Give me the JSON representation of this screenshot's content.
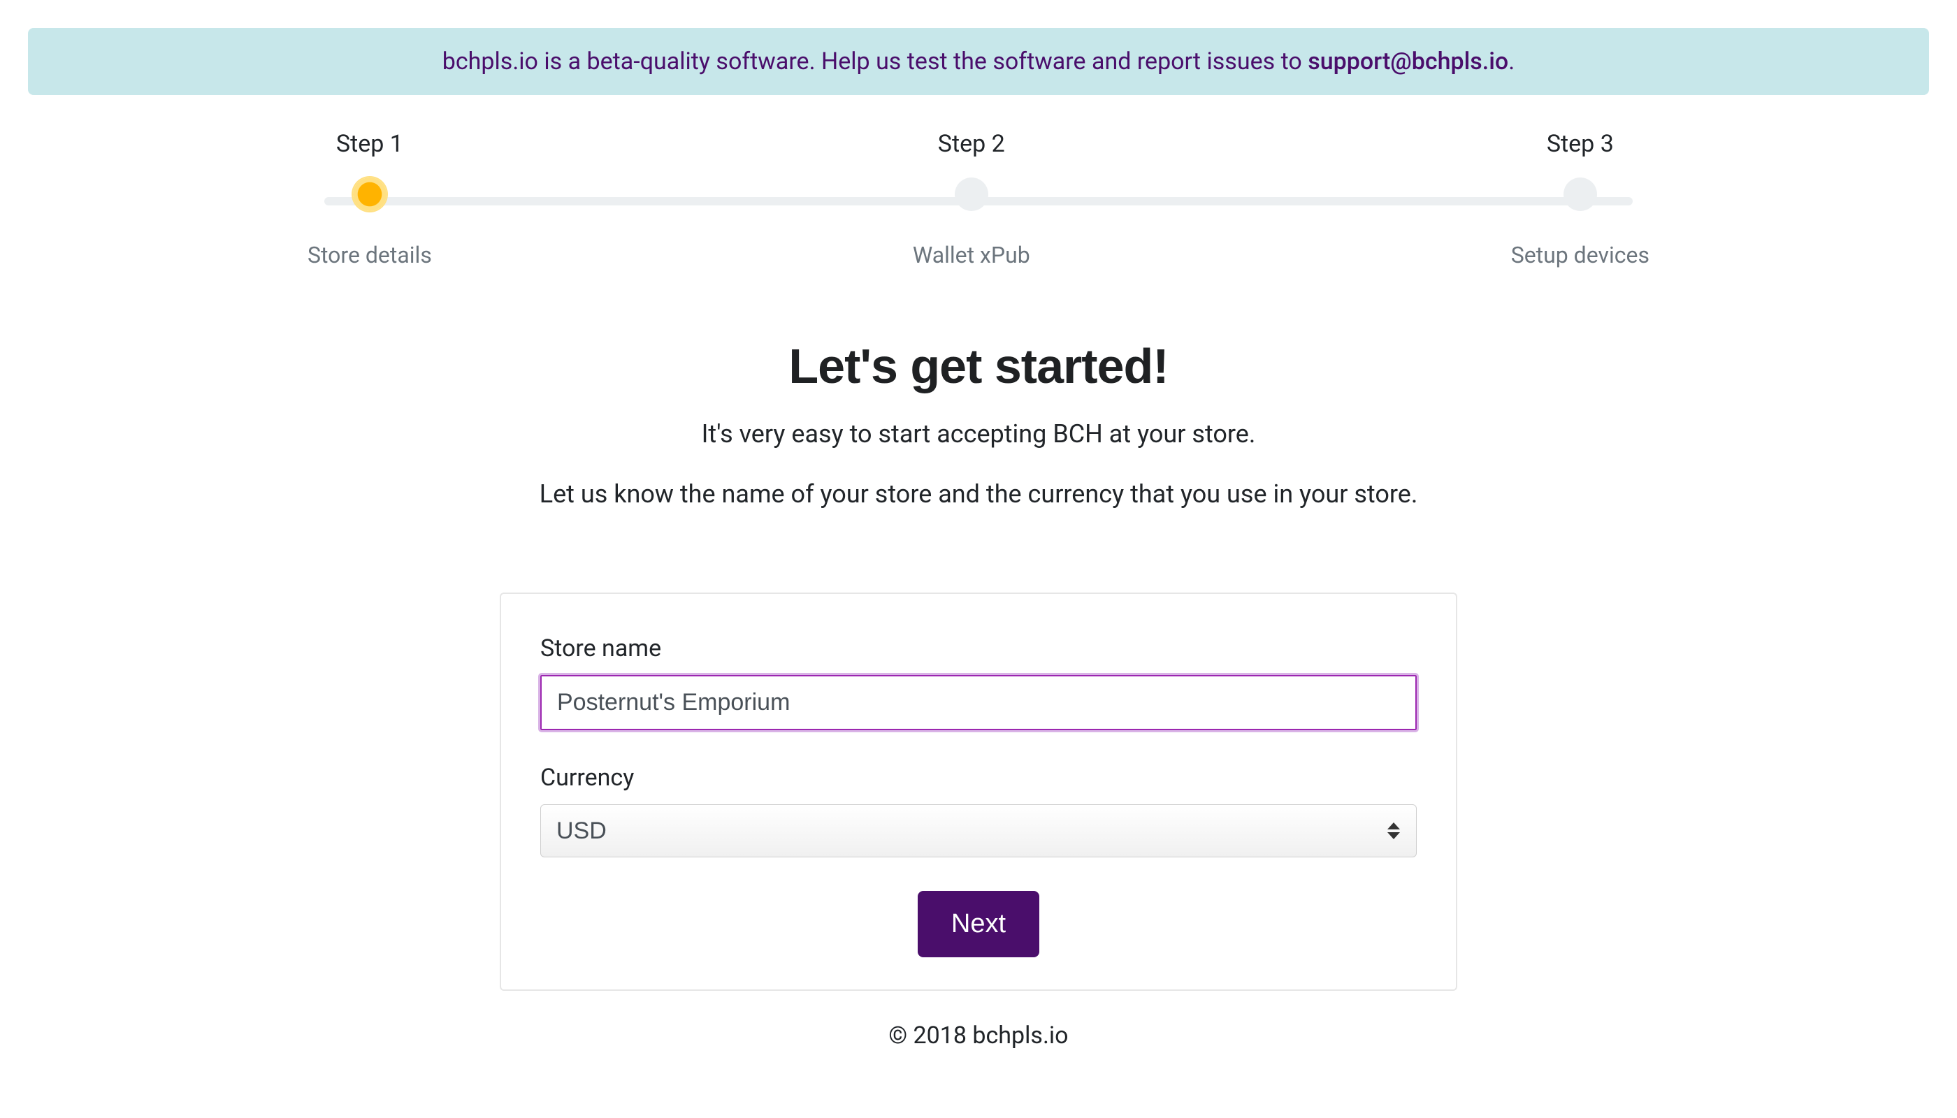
{
  "banner": {
    "text_before": "bchpls.io is a beta-quality software. Help us test the software and report issues to ",
    "email": "support@bchpls.io",
    "text_after": "."
  },
  "stepper": {
    "steps": [
      {
        "title": "Step 1",
        "subtitle": "Store details",
        "active": true
      },
      {
        "title": "Step 2",
        "subtitle": "Wallet xPub",
        "active": false
      },
      {
        "title": "Step 3",
        "subtitle": "Setup devices",
        "active": false
      }
    ]
  },
  "main": {
    "title": "Let's get started!",
    "subtitle": "It's very easy to start accepting BCH at your store.",
    "instruction": "Let us know the name of your store and the currency that you use in your store."
  },
  "form": {
    "store_name_label": "Store name",
    "store_name_value": "Posternut's Emporium ",
    "currency_label": "Currency",
    "currency_value": "USD",
    "next_button": "Next"
  },
  "footer": {
    "copyright": "© 2018 bchpls.io"
  }
}
